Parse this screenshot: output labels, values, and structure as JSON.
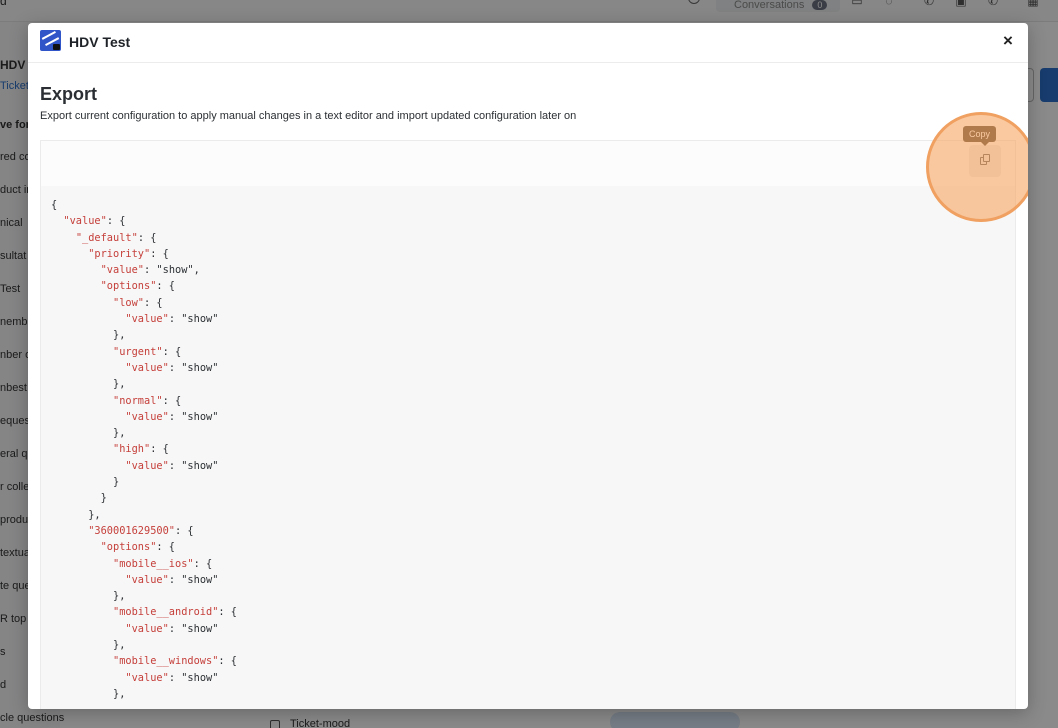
{
  "background": {
    "topbar_letter": "d",
    "conversations_label": "Conversations",
    "conversations_count": "0",
    "sidebar_header": "HDV",
    "sidebar_tab": "Ticket",
    "sidebar_items": [
      "ve for",
      "red co",
      "duct in",
      "nical",
      "sultat",
      "Test",
      "nemb",
      "nber o",
      "nbest",
      "eques",
      "eral q",
      "r colle",
      "produ",
      "textua",
      "te que",
      "R top",
      "s",
      "d",
      "cle questions"
    ],
    "bottom_label": "Ticket-mood"
  },
  "modal": {
    "app_name": "HDV Test",
    "close_label": "×",
    "section_title": "Export",
    "section_description": "Export current configuration to apply manual changes in a text editor and import updated configuration later on",
    "copy_tooltip": "Copy",
    "code_lines": [
      [
        {
          "t": "{",
          "c": "p"
        }
      ],
      [
        {
          "t": "  ",
          "c": "p"
        },
        {
          "t": "\"value\"",
          "c": "k"
        },
        {
          "t": ": {",
          "c": "p"
        }
      ],
      [
        {
          "t": "    ",
          "c": "p"
        },
        {
          "t": "\"_default\"",
          "c": "k"
        },
        {
          "t": ": {",
          "c": "p"
        }
      ],
      [
        {
          "t": "      ",
          "c": "p"
        },
        {
          "t": "\"priority\"",
          "c": "k"
        },
        {
          "t": ": {",
          "c": "p"
        }
      ],
      [
        {
          "t": "        ",
          "c": "p"
        },
        {
          "t": "\"value\"",
          "c": "k"
        },
        {
          "t": ": ",
          "c": "p"
        },
        {
          "t": "\"show\"",
          "c": "s"
        },
        {
          "t": ",",
          "c": "p"
        }
      ],
      [
        {
          "t": "        ",
          "c": "p"
        },
        {
          "t": "\"options\"",
          "c": "k"
        },
        {
          "t": ": {",
          "c": "p"
        }
      ],
      [
        {
          "t": "          ",
          "c": "p"
        },
        {
          "t": "\"low\"",
          "c": "k"
        },
        {
          "t": ": {",
          "c": "p"
        }
      ],
      [
        {
          "t": "            ",
          "c": "p"
        },
        {
          "t": "\"value\"",
          "c": "k"
        },
        {
          "t": ": ",
          "c": "p"
        },
        {
          "t": "\"show\"",
          "c": "s"
        }
      ],
      [
        {
          "t": "          },",
          "c": "p"
        }
      ],
      [
        {
          "t": "          ",
          "c": "p"
        },
        {
          "t": "\"urgent\"",
          "c": "k"
        },
        {
          "t": ": {",
          "c": "p"
        }
      ],
      [
        {
          "t": "            ",
          "c": "p"
        },
        {
          "t": "\"value\"",
          "c": "k"
        },
        {
          "t": ": ",
          "c": "p"
        },
        {
          "t": "\"show\"",
          "c": "s"
        }
      ],
      [
        {
          "t": "          },",
          "c": "p"
        }
      ],
      [
        {
          "t": "          ",
          "c": "p"
        },
        {
          "t": "\"normal\"",
          "c": "k"
        },
        {
          "t": ": {",
          "c": "p"
        }
      ],
      [
        {
          "t": "            ",
          "c": "p"
        },
        {
          "t": "\"value\"",
          "c": "k"
        },
        {
          "t": ": ",
          "c": "p"
        },
        {
          "t": "\"show\"",
          "c": "s"
        }
      ],
      [
        {
          "t": "          },",
          "c": "p"
        }
      ],
      [
        {
          "t": "          ",
          "c": "p"
        },
        {
          "t": "\"high\"",
          "c": "k"
        },
        {
          "t": ": {",
          "c": "p"
        }
      ],
      [
        {
          "t": "            ",
          "c": "p"
        },
        {
          "t": "\"value\"",
          "c": "k"
        },
        {
          "t": ": ",
          "c": "p"
        },
        {
          "t": "\"show\"",
          "c": "s"
        }
      ],
      [
        {
          "t": "          }",
          "c": "p"
        }
      ],
      [
        {
          "t": "        }",
          "c": "p"
        }
      ],
      [
        {
          "t": "      },",
          "c": "p"
        }
      ],
      [
        {
          "t": "      ",
          "c": "p"
        },
        {
          "t": "\"360001629500\"",
          "c": "k"
        },
        {
          "t": ": {",
          "c": "p"
        }
      ],
      [
        {
          "t": "        ",
          "c": "p"
        },
        {
          "t": "\"options\"",
          "c": "k"
        },
        {
          "t": ": {",
          "c": "p"
        }
      ],
      [
        {
          "t": "          ",
          "c": "p"
        },
        {
          "t": "\"mobile__ios\"",
          "c": "k"
        },
        {
          "t": ": {",
          "c": "p"
        }
      ],
      [
        {
          "t": "            ",
          "c": "p"
        },
        {
          "t": "\"value\"",
          "c": "k"
        },
        {
          "t": ": ",
          "c": "p"
        },
        {
          "t": "\"show\"",
          "c": "s"
        }
      ],
      [
        {
          "t": "          },",
          "c": "p"
        }
      ],
      [
        {
          "t": "          ",
          "c": "p"
        },
        {
          "t": "\"mobile__android\"",
          "c": "k"
        },
        {
          "t": ": {",
          "c": "p"
        }
      ],
      [
        {
          "t": "            ",
          "c": "p"
        },
        {
          "t": "\"value\"",
          "c": "k"
        },
        {
          "t": ": ",
          "c": "p"
        },
        {
          "t": "\"show\"",
          "c": "s"
        }
      ],
      [
        {
          "t": "          },",
          "c": "p"
        }
      ],
      [
        {
          "t": "          ",
          "c": "p"
        },
        {
          "t": "\"mobile__windows\"",
          "c": "k"
        },
        {
          "t": ": {",
          "c": "p"
        }
      ],
      [
        {
          "t": "            ",
          "c": "p"
        },
        {
          "t": "\"value\"",
          "c": "k"
        },
        {
          "t": ": ",
          "c": "p"
        },
        {
          "t": "\"show\"",
          "c": "s"
        }
      ],
      [
        {
          "t": "          },",
          "c": "p"
        }
      ]
    ]
  },
  "colors": {
    "json_key": "#c53f3a",
    "json_string": "#2b2f33",
    "highlight_ring": "#f0a060",
    "tooltip_bg": "#4a3b2a",
    "logo_bg": "#2f55c8"
  },
  "icons": {
    "logo": "hdv-logo-icon",
    "close": "close-icon",
    "copy": "copy-icon"
  }
}
